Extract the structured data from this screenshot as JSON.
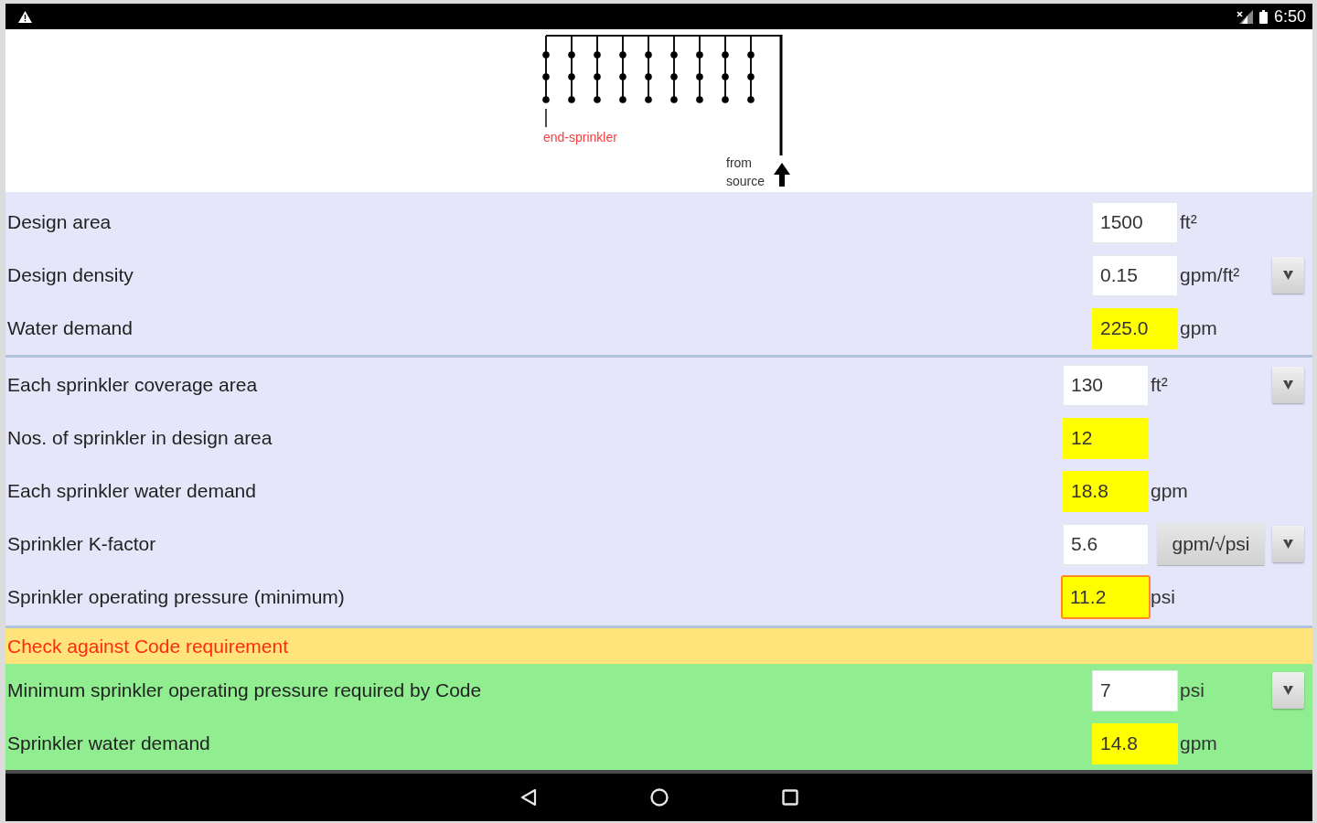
{
  "status_bar": {
    "time": "6:50"
  },
  "diagram": {
    "end_label": "end-sprinkler",
    "source_label": "from source"
  },
  "sections": [
    {
      "kind": "calculation",
      "rows": [
        {
          "label": "Design area",
          "field": {
            "value": "1500",
            "computed": false,
            "warning": false
          },
          "unit": {
            "text": "ft²",
            "kind": "text"
          },
          "dropdown": false
        },
        {
          "label": "Design density",
          "field": {
            "value": "0.15",
            "computed": false,
            "warning": false
          },
          "unit": {
            "text": "gpm/ft²",
            "kind": "text"
          },
          "dropdown": true
        },
        {
          "label": "Water demand",
          "field": {
            "value": "225.0",
            "computed": true,
            "warning": false
          },
          "unit": {
            "text": "gpm",
            "kind": "text"
          },
          "dropdown": false
        }
      ]
    },
    {
      "kind": "calculation",
      "rows": [
        {
          "label": "Each sprinkler coverage area",
          "field": {
            "value": "130",
            "computed": false,
            "warning": false
          },
          "unit": {
            "text": "ft²",
            "kind": "text"
          },
          "dropdown": true
        },
        {
          "label": "Nos. of sprinkler in design area",
          "field": {
            "value": "12",
            "computed": true,
            "warning": false
          },
          "dropdown": false
        },
        {
          "label": "Each sprinkler water demand",
          "field": {
            "value": "18.8",
            "computed": true,
            "warning": false
          },
          "unit": {
            "text": "gpm",
            "kind": "text"
          },
          "dropdown": false
        },
        {
          "label": "Sprinkler K-factor",
          "field": {
            "value": "5.6",
            "computed": false,
            "warning": false
          },
          "unit": {
            "text": "gpm/√psi",
            "kind": "button"
          },
          "dropdown": true
        },
        {
          "label": "Sprinkler operating pressure (minimum)",
          "field": {
            "value": "11.2",
            "computed": true,
            "warning": true
          },
          "unit": {
            "text": "psi",
            "kind": "text"
          },
          "dropdown": false
        }
      ]
    },
    {
      "kind": "code_check",
      "heading": "Check against Code requirement",
      "rows": [
        {
          "label": "Minimum sprinkler operating pressure required by Code",
          "field": {
            "value": "7",
            "computed": false,
            "warning": false
          },
          "unit": {
            "text": "psi",
            "kind": "text"
          },
          "dropdown": true
        },
        {
          "label": "Sprinkler water demand",
          "field": {
            "value": "14.8",
            "computed": true,
            "warning": false
          },
          "unit": {
            "text": "gpm",
            "kind": "text"
          },
          "dropdown": false
        }
      ]
    }
  ]
}
